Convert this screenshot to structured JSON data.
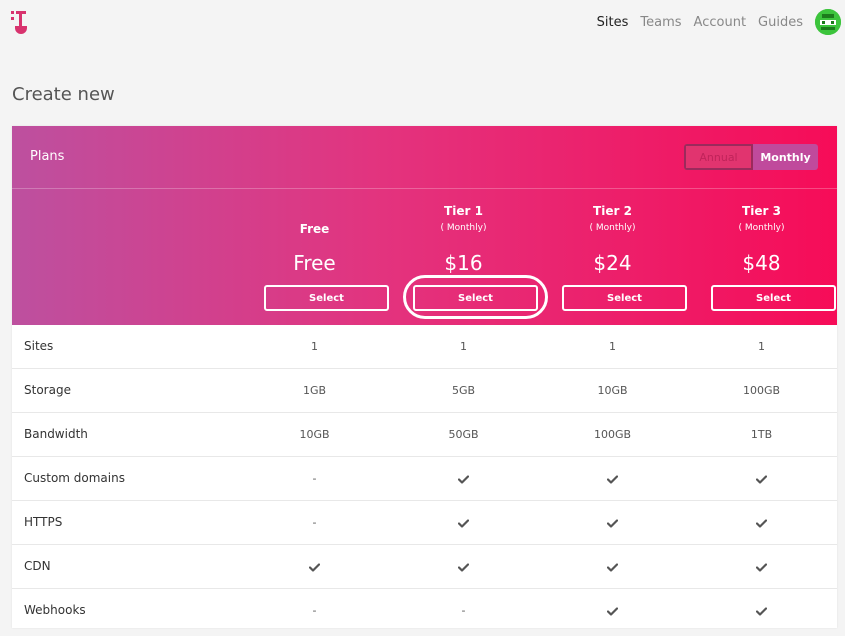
{
  "nav": {
    "items": [
      {
        "label": "Sites",
        "active": true
      },
      {
        "label": "Teams",
        "active": false
      },
      {
        "label": "Account",
        "active": false
      },
      {
        "label": "Guides",
        "active": false
      }
    ]
  },
  "page": {
    "title": "Create new"
  },
  "plans": {
    "title": "Plans",
    "toggle": {
      "options": [
        "Annual",
        "Monthly"
      ],
      "selected": "Monthly"
    },
    "columns": [
      {
        "name": "Free",
        "period": "",
        "price": "Free",
        "button": "Select"
      },
      {
        "name": "Tier 1",
        "period": "( Monthly)",
        "price": "$16",
        "button": "Select"
      },
      {
        "name": "Tier 2",
        "period": "( Monthly)",
        "price": "$24",
        "button": "Select"
      },
      {
        "name": "Tier 3",
        "period": "( Monthly)",
        "price": "$48",
        "button": "Select"
      }
    ],
    "features": [
      {
        "label": "Sites",
        "values": [
          "1",
          "1",
          "1",
          "1"
        ]
      },
      {
        "label": "Storage",
        "values": [
          "1GB",
          "5GB",
          "10GB",
          "100GB"
        ]
      },
      {
        "label": "Bandwidth",
        "values": [
          "10GB",
          "50GB",
          "100GB",
          "1TB"
        ]
      },
      {
        "label": "Custom domains",
        "values": [
          "-",
          "check",
          "check",
          "check"
        ]
      },
      {
        "label": "HTTPS",
        "values": [
          "-",
          "check",
          "check",
          "check"
        ]
      },
      {
        "label": "CDN",
        "values": [
          "check",
          "check",
          "check",
          "check"
        ]
      },
      {
        "label": "Webhooks",
        "values": [
          "-",
          "-",
          "check",
          "check"
        ]
      }
    ]
  },
  "colors": {
    "accent": "#f60c58",
    "gradient_start": "#bd509f",
    "check": "#555555"
  }
}
